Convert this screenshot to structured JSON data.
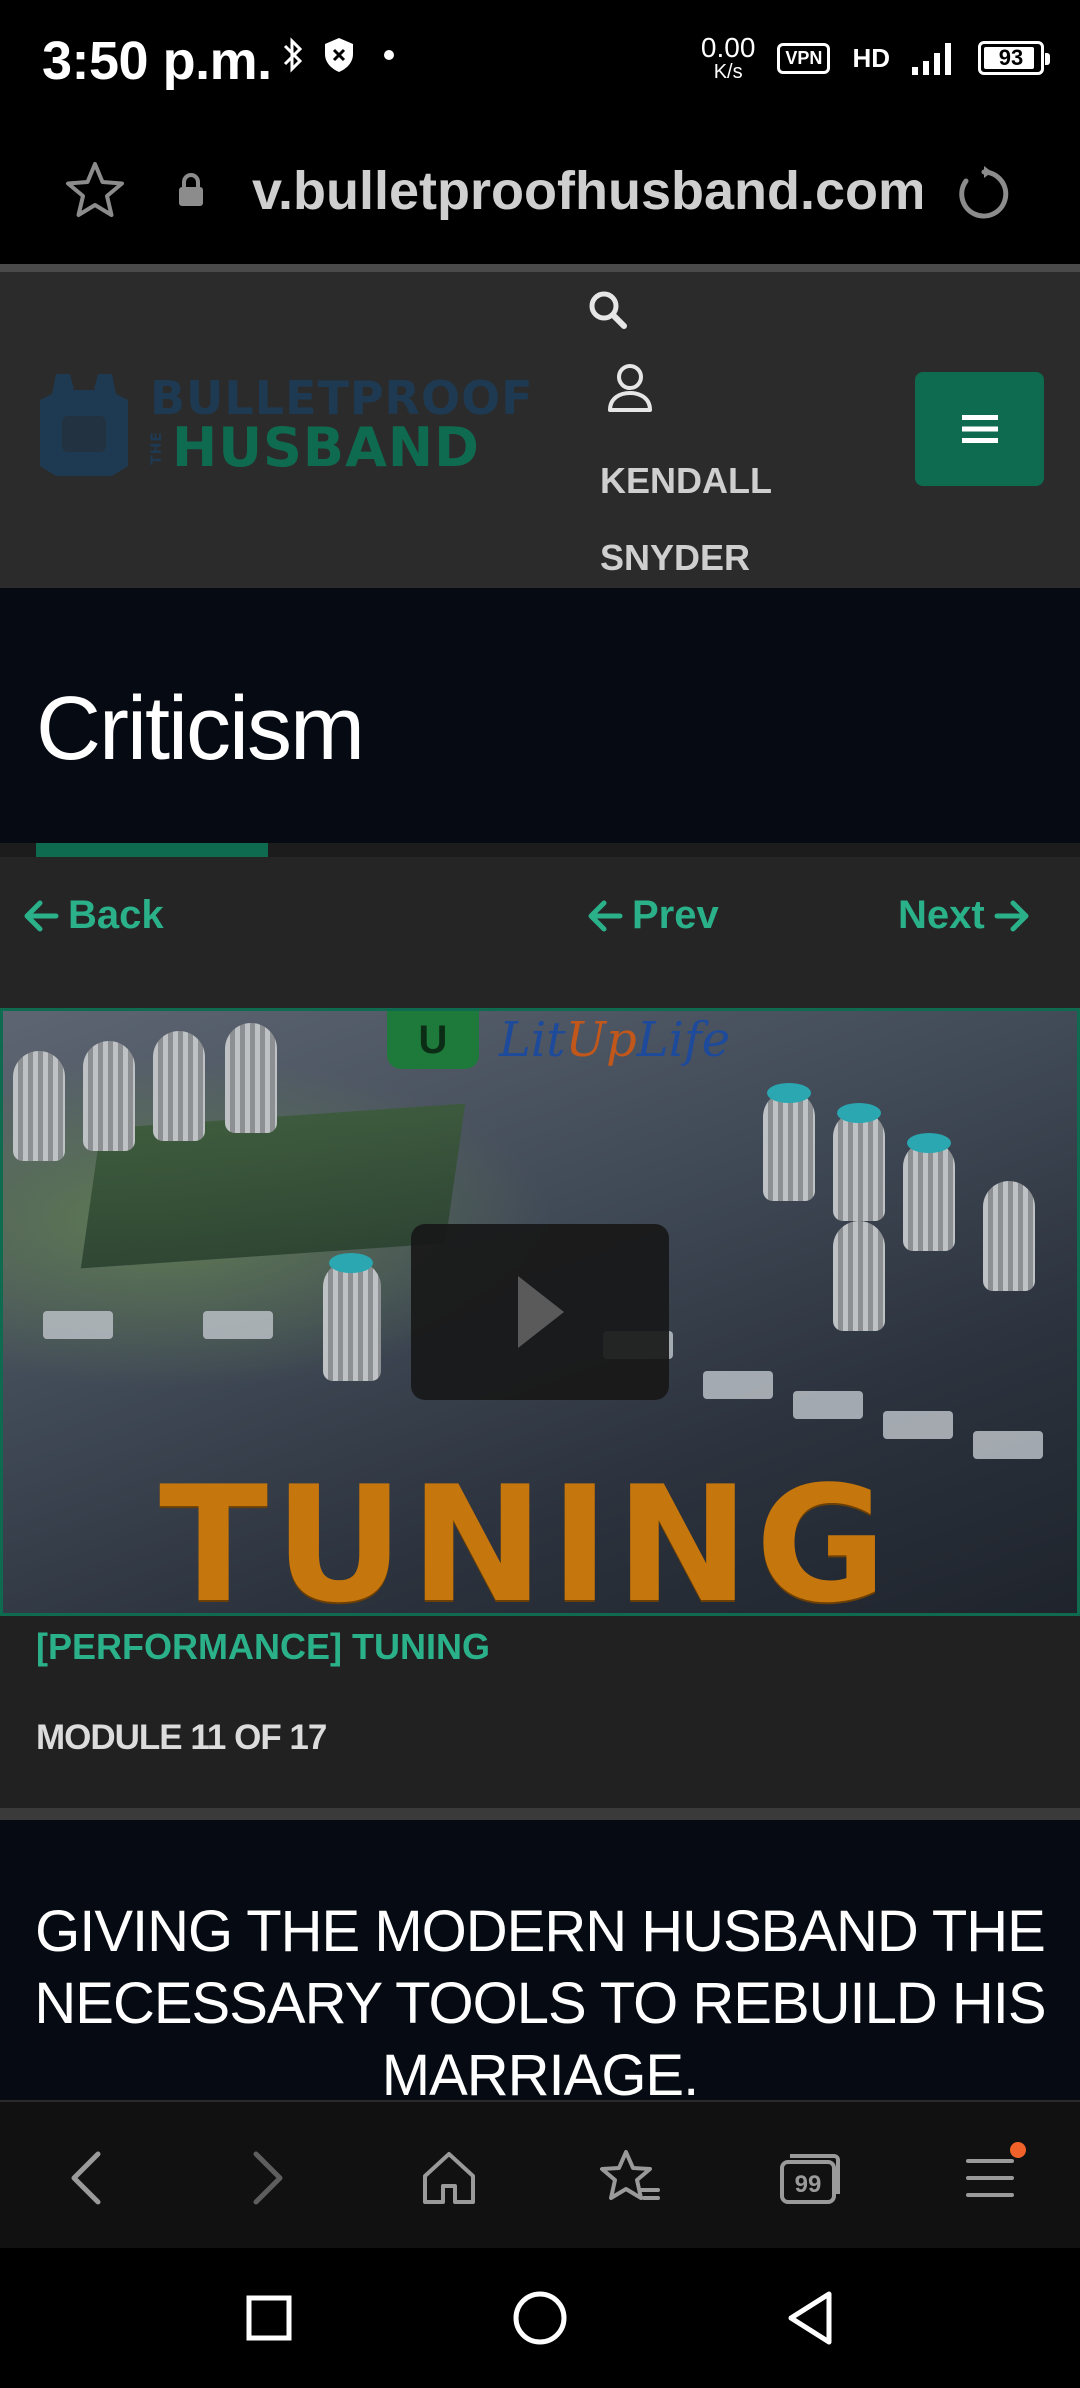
{
  "status_bar": {
    "time": "3:50 p.m.",
    "net_speed_value": "0.00",
    "net_speed_unit": "K/s",
    "vpn_label": "VPN",
    "hd_label": "HD",
    "battery_level": "93",
    "battery_fraction": 0.93
  },
  "browser": {
    "url": "v.bulletproofhusband.com"
  },
  "site_header": {
    "logo_line1": "BULLETPROOF",
    "logo_the": "THE",
    "logo_line2": "HUSBAND",
    "user_first_name": "KENDALL",
    "user_last_name": "SNYDER"
  },
  "page": {
    "title": "Criticism",
    "progress_fraction": 0.215
  },
  "lesson_nav": {
    "back_label": "Back",
    "prev_label": "Prev",
    "next_label": "Next"
  },
  "video": {
    "channel_letter": "U",
    "channel_name_prefix": "Lit",
    "channel_name_accent": "Up",
    "channel_name_suffix": "Life",
    "overlay_word": "TUNING"
  },
  "module": {
    "subtitle": "[PERFORMANCE] TUNING",
    "count_label": "MODULE 11 OF 17"
  },
  "tagline": {
    "text": "GIVING THE MODERN HUSBAND THE NECESSARY TOOLS TO REBUILD HIS MARRIAGE."
  },
  "colors": {
    "accent_green": "#0f6b4f",
    "link_green": "#2bb18a",
    "notification_orange": "#f0622a"
  },
  "icons": [
    "star-icon",
    "lock-icon",
    "reload-icon",
    "search-icon",
    "user-icon",
    "hamburger-icon",
    "arrow-left-icon",
    "arrow-right-icon",
    "play-icon",
    "back-chevron-icon",
    "forward-chevron-icon",
    "home-icon",
    "bookmarks-icon",
    "tabs-icon",
    "menu-icon",
    "recents-icon",
    "home-circle-icon",
    "back-triangle-icon"
  ]
}
